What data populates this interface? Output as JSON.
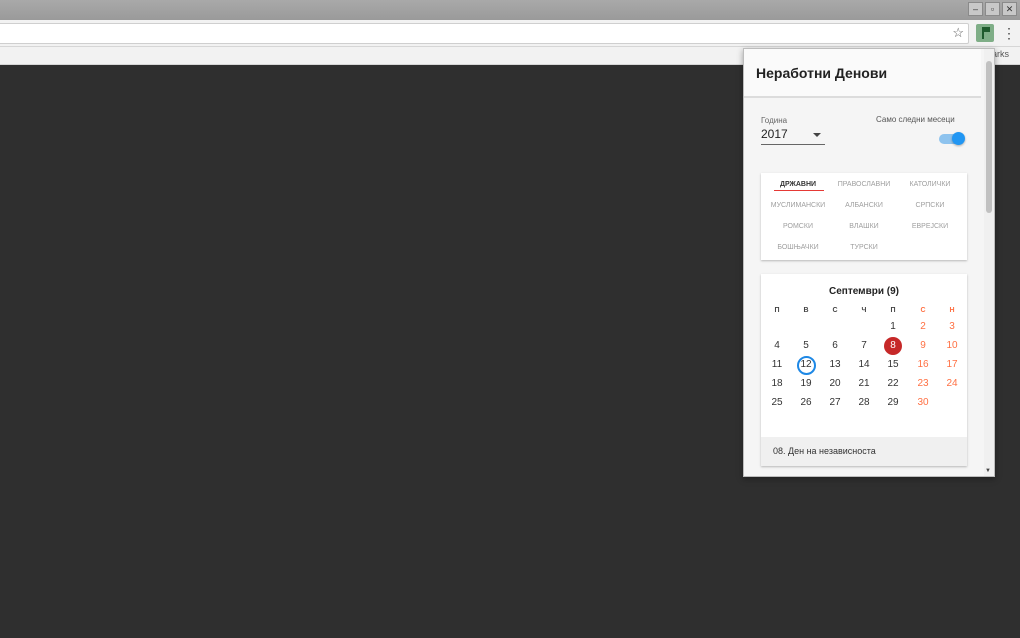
{
  "browser": {
    "window_buttons": [
      "–",
      "▫",
      "✕"
    ],
    "bookmarks_bar_text": "arks"
  },
  "popup": {
    "title": "Неработни Денови",
    "year_label": "Година",
    "year_value": "2017",
    "toggle_label": "Само следни месеци",
    "toggle_on": true,
    "categories": [
      {
        "label": "ДРЖАВНИ",
        "active": true
      },
      {
        "label": "ПРАВОСЛАВНИ",
        "active": false
      },
      {
        "label": "КАТОЛИЧКИ",
        "active": false
      },
      {
        "label": "МУСЛИМАНСКИ",
        "active": false
      },
      {
        "label": "АЛБАНСКИ",
        "active": false
      },
      {
        "label": "СРПСКИ",
        "active": false
      },
      {
        "label": "РОМСКИ",
        "active": false
      },
      {
        "label": "ВЛАШКИ",
        "active": false
      },
      {
        "label": "ЕВРЕЈСКИ",
        "active": false
      },
      {
        "label": "БОШЊАЧКИ",
        "active": false
      },
      {
        "label": "ТУРСКИ",
        "active": false
      }
    ],
    "calendar": {
      "month_title": "Септември (9)",
      "weekdays": [
        "П",
        "В",
        "С",
        "Ч",
        "П",
        "С",
        "Н"
      ],
      "weeks": [
        [
          "",
          "",
          "",
          "",
          "1",
          "2",
          "3"
        ],
        [
          "4",
          "5",
          "6",
          "7",
          "8",
          "9",
          "10"
        ],
        [
          "11",
          "12",
          "13",
          "14",
          "15",
          "16",
          "17"
        ],
        [
          "18",
          "19",
          "20",
          "21",
          "22",
          "23",
          "24"
        ],
        [
          "25",
          "26",
          "27",
          "28",
          "29",
          "30",
          ""
        ]
      ],
      "holiday_day": "8",
      "today_day": "12",
      "holiday_text": "08. Ден на независноста"
    }
  },
  "colors": {
    "accent_blue": "#2196f3",
    "holiday_red": "#c62828",
    "weekend_orange": "#ff7043",
    "tab_underline": "#e53935"
  }
}
